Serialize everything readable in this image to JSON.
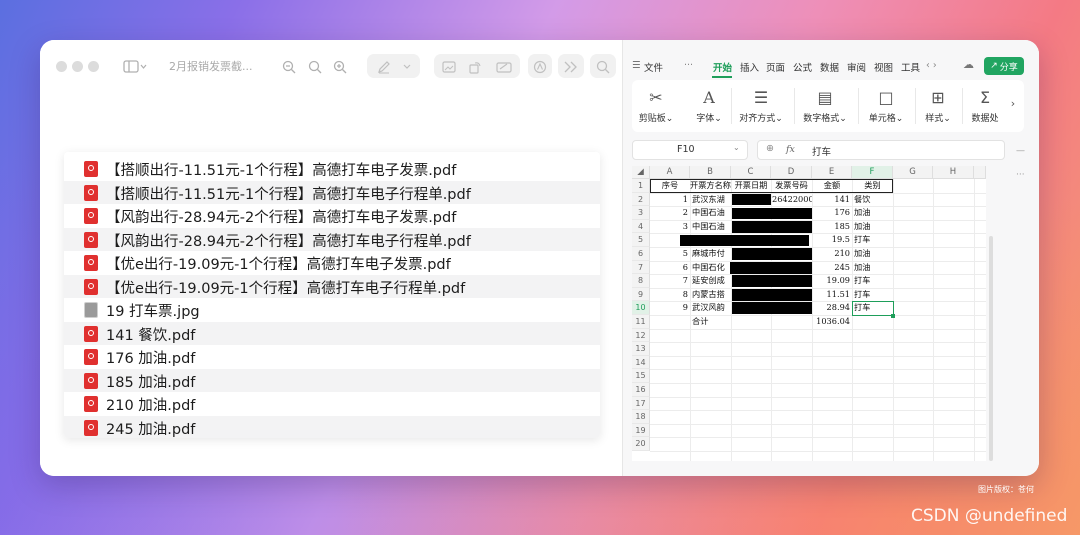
{
  "preview": {
    "title": "2月报销发票截...",
    "files": [
      {
        "name": "【搭顺出行-11.51元-1个行程】高德打车电子发票.pdf",
        "icon": "pdf-icon"
      },
      {
        "name": "【搭顺出行-11.51元-1个行程】高德打车电子行程单.pdf",
        "icon": "pdf-icon"
      },
      {
        "name": "【风韵出行-28.94元-2个行程】高德打车电子发票.pdf",
        "icon": "pdf-icon"
      },
      {
        "name": "【风韵出行-28.94元-2个行程】高德打车电子行程单.pdf",
        "icon": "pdf-icon"
      },
      {
        "name": "【优e出行-19.09元-1个行程】高德打车电子发票.pdf",
        "icon": "pdf-icon"
      },
      {
        "name": "【优e出行-19.09元-1个行程】高德打车电子行程单.pdf",
        "icon": "pdf-icon"
      },
      {
        "name": "19  打车票.jpg",
        "icon": "image-icon"
      },
      {
        "name": "141  餐饮.pdf",
        "icon": "pdf-icon"
      },
      {
        "name": "176  加油.pdf",
        "icon": "pdf-icon"
      },
      {
        "name": "185 加油.pdf",
        "icon": "pdf-icon"
      },
      {
        "name": "210 加油.pdf",
        "icon": "pdf-icon"
      },
      {
        "name": "245 加油.pdf",
        "icon": "pdf-icon"
      }
    ]
  },
  "wps": {
    "menu": {
      "file": "文件",
      "more": "···",
      "tabs": [
        "开始",
        "插入",
        "页面",
        "公式",
        "数据",
        "审阅",
        "视图",
        "工具"
      ],
      "active_tab": "开始",
      "share": "分享"
    },
    "ribbon": {
      "clipboard": "剪贴板",
      "font": "字体",
      "align": "对齐方式",
      "number": "数字格式",
      "cells": "单元格",
      "styles": "样式",
      "data": "数据处"
    },
    "namebox": "F10",
    "fx_label": "fx",
    "formula_value": "打车",
    "columns": [
      "A",
      "B",
      "C",
      "D",
      "E",
      "F",
      "G",
      "H"
    ],
    "rows": [
      "1",
      "2",
      "3",
      "4",
      "5",
      "6",
      "7",
      "8",
      "9",
      "10",
      "11",
      "12",
      "13",
      "14",
      "15",
      "16",
      "17",
      "18",
      "19",
      "20"
    ],
    "headers": {
      "a": "序号",
      "b": "开票方名称",
      "c": "开票日期",
      "d": "发票号码",
      "e": "金额",
      "f": "类别"
    },
    "table": [
      {
        "seq": "1",
        "name": "武汉东湖",
        "invoice_no": "264220000",
        "amount": "141",
        "category": "餐饮"
      },
      {
        "seq": "2",
        "name": "中国石油",
        "invoice_no": "",
        "amount": "176",
        "category": "加油"
      },
      {
        "seq": "3",
        "name": "中国石油",
        "invoice_no": "",
        "amount": "185",
        "category": "加油"
      },
      {
        "seq": "",
        "name": "",
        "invoice_no": "",
        "amount": "19.5",
        "category": "打车"
      },
      {
        "seq": "5",
        "name": "麻城市付",
        "invoice_no": "",
        "amount": "210",
        "category": "加油"
      },
      {
        "seq": "6",
        "name": "中国石化",
        "invoice_no": "",
        "amount": "245",
        "category": "加油"
      },
      {
        "seq": "7",
        "name": "延安创成",
        "invoice_no": "",
        "amount": "19.09",
        "category": "打车"
      },
      {
        "seq": "8",
        "name": "内蒙古搭",
        "invoice_no": "",
        "amount": "11.51",
        "category": "打车"
      },
      {
        "seq": "9",
        "name": "武汉风韵",
        "invoice_no": "",
        "amount": "28.94",
        "category": "打车"
      }
    ],
    "total_label": "合计",
    "total_value": "1036.04"
  },
  "watermark_small": "图片版权：苍何",
  "watermark": "CSDN @undefined"
}
